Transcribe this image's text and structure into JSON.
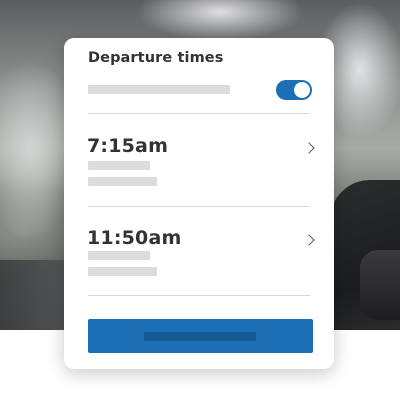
{
  "card": {
    "title": "Departure times",
    "toggle": {
      "state": "on",
      "color": "#1a6fb5"
    },
    "departures": [
      {
        "time": "7:15am",
        "icon": "chevron-right-icon"
      },
      {
        "time": "11:50am",
        "icon": "chevron-right-icon"
      }
    ],
    "primary_button": {
      "color": "#1a6fb5"
    }
  },
  "colors": {
    "accent": "#1a6fb5",
    "text": "#333333",
    "placeholder": "#dcdcdc"
  }
}
